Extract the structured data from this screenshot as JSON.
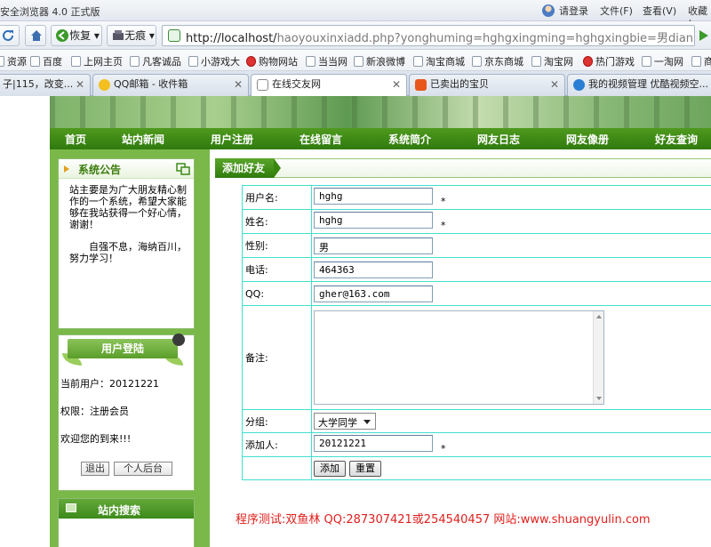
{
  "browser": {
    "window_title": "安全浏览器 4.0 正式版",
    "login": "请登录",
    "menu_file": "文件(F)",
    "menu_view": "查看(V)",
    "menu_favorites": "收藏(",
    "back_label": "恢复",
    "mode_label": "无痕",
    "url_host": "http://localhost/",
    "url_rest": "haoyouxinxiadd.php?yonghuming=hghgxingming=hghgxingbie=男dianhua=",
    "favorites": [
      {
        "label": "资源",
        "icon": "folder-icon"
      },
      {
        "label": "百度",
        "icon": "folder-icon"
      },
      {
        "label": "上网主页",
        "icon": "folder-icon"
      },
      {
        "label": "凡客诚品",
        "icon": "folder-icon"
      },
      {
        "label": "小游戏大",
        "icon": "folder-icon"
      },
      {
        "label": "购物网站",
        "icon": "shopping-icon"
      },
      {
        "label": "当当网",
        "icon": "folder-icon"
      },
      {
        "label": "新浪微博",
        "icon": "folder-icon"
      },
      {
        "label": "淘宝商城",
        "icon": "folder-icon"
      },
      {
        "label": "京东商城",
        "icon": "folder-icon"
      },
      {
        "label": "淘宝网",
        "icon": "folder-icon"
      },
      {
        "label": "热门游戏",
        "icon": "game-icon"
      },
      {
        "label": "一淘网",
        "icon": "folder-icon"
      },
      {
        "label": "商",
        "icon": "folder-icon"
      }
    ],
    "tabs": [
      {
        "label": "子|115，改变..."
      },
      {
        "label": "QQ邮箱 - 收件箱"
      },
      {
        "label": "在线交友网"
      },
      {
        "label": "已卖出的宝贝"
      },
      {
        "label": "我的视频管理 优酷视频空..."
      }
    ]
  },
  "site": {
    "menu": [
      "首页",
      "站内新闻",
      "用户注册",
      "在线留言",
      "系统简介",
      "网友日志",
      "网友像册",
      "好友查询"
    ],
    "notice": {
      "title": "系统公告",
      "text1": "站主要是为广大朋友精心制作的一个系统，希望大家能够在我站获得一个好心情，谢谢！",
      "text2": "自强不息，海纳百川，努力学习！"
    },
    "login_box": {
      "title": "用户登陆",
      "current_user": "当前用户：20121221",
      "permission": "权限：注册会员",
      "welcome": "欢迎您的到来!!!",
      "logout": "退出",
      "admin": "个人后台"
    },
    "search_box": {
      "title": "站内搜索"
    },
    "form": {
      "title": "添加好友",
      "username_label": "用户名:",
      "username": "hghg",
      "name_label": "姓名:",
      "name": "hghg",
      "gender_label": "性别:",
      "gender": "男",
      "phone_label": "电话:",
      "phone": "464363",
      "qq_label": "QQ:",
      "qq": "gher@163.com",
      "remark_label": "备注:",
      "remark": "",
      "group_label": "分组:",
      "group": "大学同学",
      "adder_label": "添加人:",
      "adder": "20121221",
      "required_mark": "*",
      "submit": "添加",
      "reset": "重置"
    },
    "footer_note": "程序测试:双鱼林 QQ:287307421或254540457 网站:www.shuangyulin.com"
  }
}
